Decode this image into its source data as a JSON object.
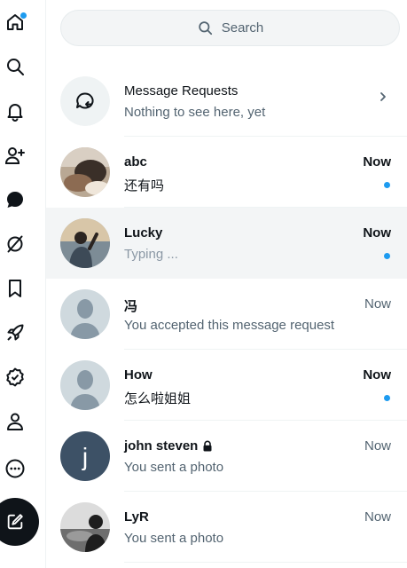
{
  "search": {
    "placeholder": "Search"
  },
  "requests": {
    "title": "Message Requests",
    "subtitle": "Nothing to see here, yet"
  },
  "conversations": [
    {
      "name": "abc",
      "preview": "还有吗",
      "time": "Now",
      "unread": true
    },
    {
      "name": "Lucky",
      "preview": "Typing ...",
      "time": "Now",
      "unread": true,
      "selected": true
    },
    {
      "name": "冯",
      "preview": "You accepted this message request",
      "time": "Now",
      "unread": false
    },
    {
      "name": "How",
      "preview": "怎么啦姐姐",
      "time": "Now",
      "unread": true
    },
    {
      "name": "john steven",
      "preview": "You sent a photo",
      "time": "Now",
      "unread": false,
      "locked": true,
      "avatar_letter": "j"
    },
    {
      "name": "LyR",
      "preview": "You sent a photo",
      "time": "Now",
      "unread": false
    }
  ],
  "colors": {
    "accent": "#1d9bf0",
    "text": "#0f1419",
    "muted": "#536471",
    "selected_bg": "#f3f5f6",
    "placeholder_avatar": "#cfd9de",
    "j_avatar": "#3d5166"
  },
  "icons": [
    "home-icon",
    "search-icon",
    "bell-icon",
    "person-add-icon",
    "messages-icon",
    "premium-slash-icon",
    "bookmark-icon",
    "rocket-icon",
    "verified-badge-icon",
    "profile-icon",
    "more-icon",
    "compose-icon"
  ]
}
